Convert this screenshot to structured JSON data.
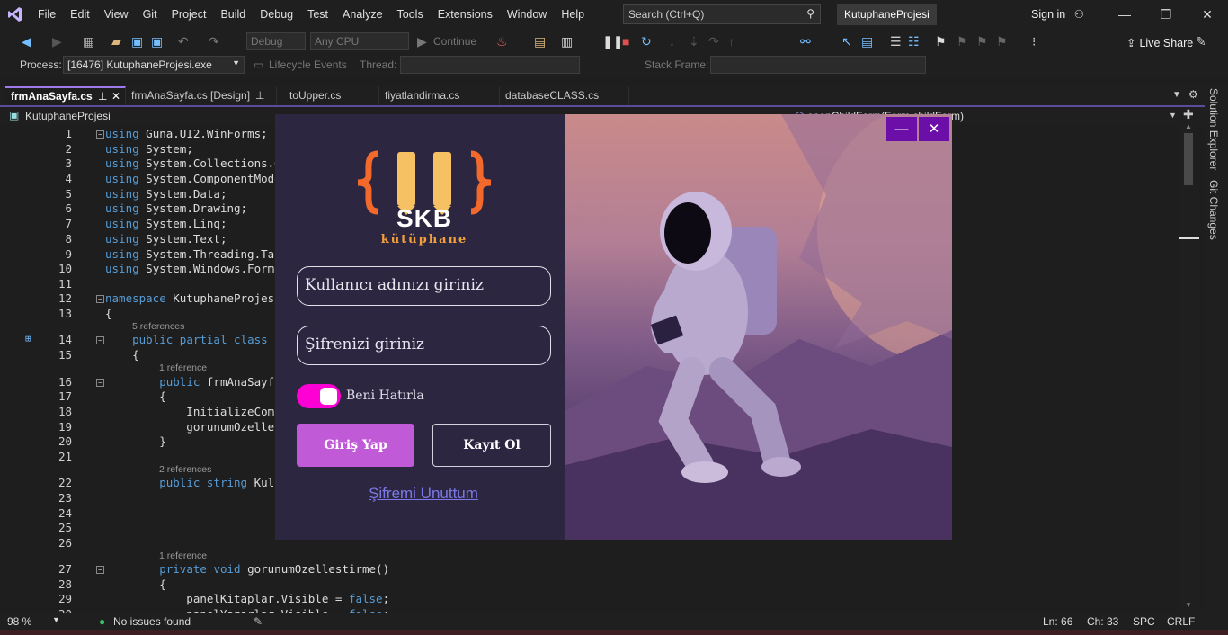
{
  "titlebar": {
    "menu": [
      "File",
      "Edit",
      "View",
      "Git",
      "Project",
      "Build",
      "Debug",
      "Test",
      "Analyze",
      "Tools",
      "Extensions",
      "Window",
      "Help"
    ],
    "search_placeholder": "Search (Ctrl+Q)",
    "project_name": "KutuphaneProjesi",
    "sign_in": "Sign in"
  },
  "toolbar": {
    "config": "Debug",
    "platform": "Any CPU",
    "continue": "Continue",
    "live_share": "Live Share"
  },
  "toolbar2": {
    "process_label": "Process:",
    "process_value": "[16476] KutuphaneProjesi.exe",
    "lifecycle": "Lifecycle Events",
    "thread_label": "Thread:",
    "stack_label": "Stack Frame:"
  },
  "tabs": [
    {
      "label": "frmAnaSayfa.cs"
    },
    {
      "label": "frmAnaSayfa.cs [Design]"
    },
    {
      "label": "toUpper.cs"
    },
    {
      "label": "fiyatlandirma.cs"
    },
    {
      "label": "databaseCLASS.cs"
    }
  ],
  "navbar": {
    "project": "KutuphaneProjesi",
    "member": "openChildForm(Form childForm)"
  },
  "code_lines": [
    {
      "n": "1",
      "code": "using Guna.UI2.WinForms;"
    },
    {
      "n": "2",
      "code": "using System;"
    },
    {
      "n": "3",
      "code": "using System.Collections.G"
    },
    {
      "n": "4",
      "code": "using System.ComponentMode"
    },
    {
      "n": "5",
      "code": "using System.Data;"
    },
    {
      "n": "6",
      "code": "using System.Drawing;"
    },
    {
      "n": "7",
      "code": "using System.Linq;"
    },
    {
      "n": "8",
      "code": "using System.Text;"
    },
    {
      "n": "9",
      "code": "using System.Threading.Tas"
    },
    {
      "n": "10",
      "code": "using System.Windows.Forms"
    },
    {
      "n": "11",
      "code": ""
    },
    {
      "n": "12",
      "code": "namespace KutuphaneProjesi"
    },
    {
      "n": "13",
      "code": "{"
    },
    {
      "n": "14",
      "code": "    public partial class f"
    },
    {
      "n": "15",
      "code": "    {"
    },
    {
      "n": "16",
      "code": "        public frmAnaSayfa"
    },
    {
      "n": "17",
      "code": "        {"
    },
    {
      "n": "18",
      "code": "            InitializeComp"
    },
    {
      "n": "19",
      "code": "            gorunumOzelles"
    },
    {
      "n": "20",
      "code": "        }"
    },
    {
      "n": "21",
      "code": ""
    },
    {
      "n": "22",
      "code": "        public string Kull"
    },
    {
      "n": "23",
      "code": ""
    },
    {
      "n": "24",
      "code": ""
    },
    {
      "n": "25",
      "code": ""
    },
    {
      "n": "26",
      "code": ""
    },
    {
      "n": "27",
      "code": "        private void gorunumOzellestirme()"
    },
    {
      "n": "28",
      "code": "        {"
    },
    {
      "n": "29",
      "code": "            panelKitaplar.Visible = false;"
    },
    {
      "n": "30",
      "code": "            panelYazarlar.Visible = false;"
    }
  ],
  "references": {
    "r5": "5 references",
    "r1a": "1 reference",
    "r2": "2 references",
    "r1b": "1 reference"
  },
  "login_form": {
    "logo_text": "SKB",
    "logo_sub": "kütüphane",
    "username_placeholder": "Kullanıcı adınızı giriniz",
    "password_placeholder": "Şifrenizi giriniz",
    "remember_label": "Beni Hatırla",
    "remember_checked": true,
    "login_button": "Giriş Yap",
    "register_button": "Kayıt Ol",
    "forgot_link": "Şifremi Unuttum",
    "colors": {
      "background": "#2d2640",
      "primary": "#c05ad6",
      "toggle": "#ff00d4",
      "title_buttons": "#6b0fa8"
    }
  },
  "side_panel": [
    "Solution Explorer",
    "Git Changes"
  ],
  "statusbar": {
    "zoom": "98 %",
    "issues": "No issues found",
    "line": "Ln: 66",
    "col": "Ch: 33",
    "spc": "SPC",
    "eol": "CRLF"
  }
}
